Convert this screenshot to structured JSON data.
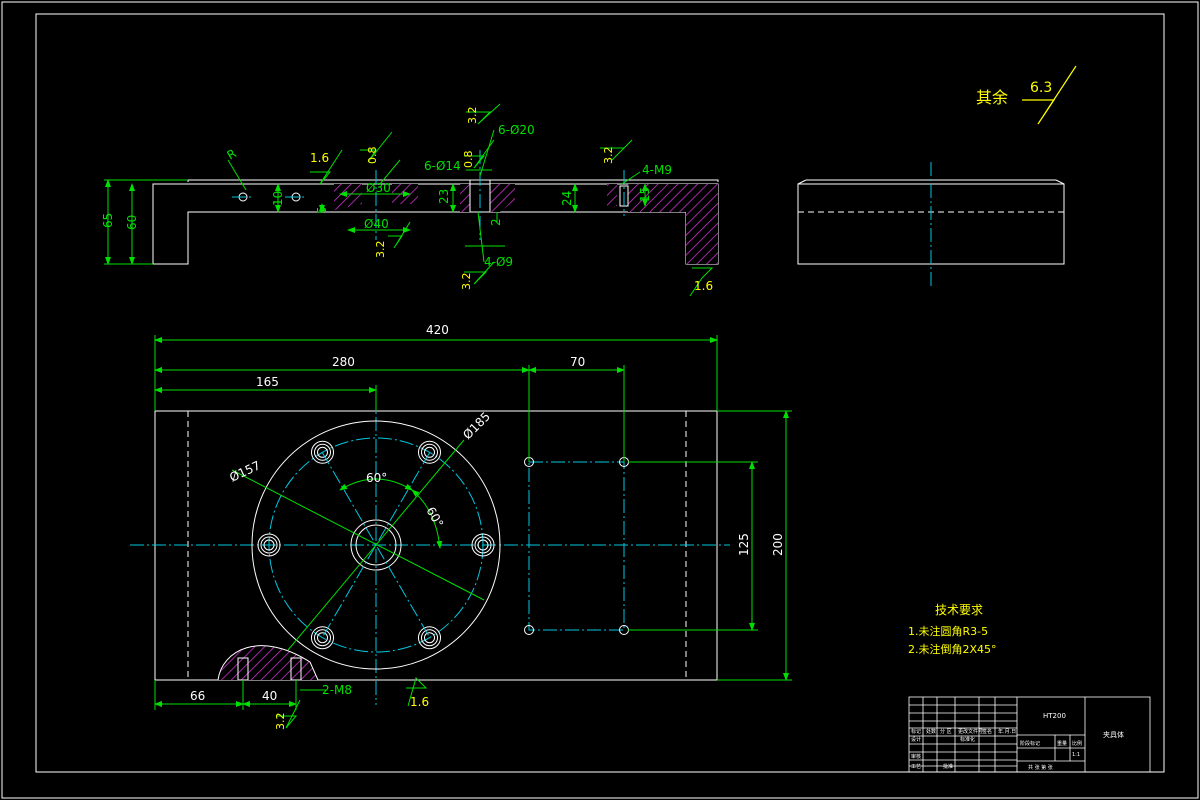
{
  "surface_symbol": {
    "prefix": "其余",
    "value": "6.3"
  },
  "top_view": {
    "labels": {
      "r": "R",
      "ra_1_6_top": "1.6",
      "ra_0_8_a": "0.8",
      "dia30": "Ø30",
      "dia40": "Ø40",
      "ra_3_2_a": "3.2",
      "six_dia14": "6-Ø14",
      "ra_0_8_b": "0.8",
      "ra_3_2_b": "3.2",
      "six_dia20": "6-Ø20",
      "ra_3_2_c": "3.2",
      "four_dia9": "4-Ø9",
      "ra_3_2_d": "3.2",
      "four_m9": "4-M9",
      "ra_3_2_e": "3.2",
      "ra_1_6_right": "1.6",
      "d65": "65",
      "d60": "60",
      "d10": "10",
      "d5": "5",
      "d23": "23",
      "d2": "2",
      "d24": "24",
      "d15": "15"
    }
  },
  "plan_view": {
    "labels": {
      "d420": "420",
      "d280": "280",
      "d70": "70",
      "d165": "165",
      "d185": "Ø185",
      "d157": "Ø157",
      "a60a": "60°",
      "a60b": "60°",
      "d125": "125",
      "d200": "200",
      "d66": "66",
      "d40": "40",
      "two_m8": "2-M8",
      "ra_1_6": "1.6",
      "ra_3_2": "3.2"
    }
  },
  "tech_req": {
    "title": "技术要求",
    "items": [
      "1.未注圆角R3-5",
      "2.未注倒角2X45°"
    ]
  },
  "title_block": {
    "material": "HT200",
    "name": "夹具体",
    "cells": [
      "标记",
      "处数",
      "分 区",
      "更改文件号",
      "签名",
      "年.月.日",
      "设计",
      "标准化",
      "阶段标记",
      "重量",
      "比例",
      "审核",
      "工艺",
      "批准",
      "共 张 第 张",
      "1:1"
    ]
  }
}
